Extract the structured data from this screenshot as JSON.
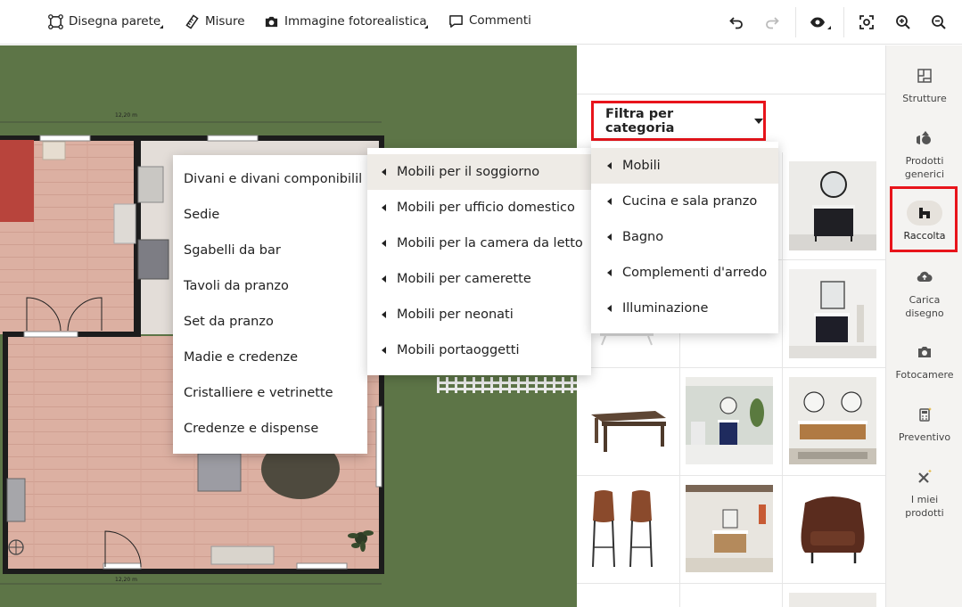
{
  "toolbar": {
    "draw_wall": "Disegna parete",
    "measures": "Misure",
    "photo_image": "Immagine fotorealistica",
    "comments": "Commenti"
  },
  "canvas": {
    "dimension_top": "12,20 m",
    "dimension_bottom": "12,20 m",
    "colors": {
      "grass": "#5d7547",
      "floor": "#dcb0a2",
      "wall": "#1c1c1c"
    }
  },
  "catalog": {
    "filter_label": "Filtra per categoria",
    "categories": [
      {
        "label": "Mobili",
        "active": true
      },
      {
        "label": "Cucina e sala pranzo",
        "active": false
      },
      {
        "label": "Bagno",
        "active": false
      },
      {
        "label": "Complementi d'arredo",
        "active": false
      },
      {
        "label": "Illuminazione",
        "active": false
      }
    ],
    "subcategories": [
      {
        "label": "Mobili per il soggiorno",
        "active": true
      },
      {
        "label": "Mobili per ufficio domestico",
        "active": false
      },
      {
        "label": "Mobili per la camera da letto",
        "active": false
      },
      {
        "label": "Mobili per camerette",
        "active": false
      },
      {
        "label": "Mobili per neonati",
        "active": false
      },
      {
        "label": "Mobili portaoggetti",
        "active": false
      }
    ],
    "items": [
      "Divani e divani componibilil",
      "Sedie",
      "Sgabelli da bar",
      "Tavoli da pranzo",
      "Set da pranzo",
      "Madie e credenze",
      "Cristalliere e vetrinette",
      "Credenze e dispense"
    ],
    "accent_color": "#e8141b"
  },
  "sidebar": {
    "items": [
      {
        "label": "Strutture",
        "icon": "structures-icon"
      },
      {
        "label": "Prodotti generici",
        "icon": "generic-products-icon"
      },
      {
        "label": "Raccolta",
        "icon": "collection-icon",
        "selected": true
      },
      {
        "label": "Carica disegno",
        "icon": "upload-cloud-icon"
      },
      {
        "label": "Fotocamere",
        "icon": "camera-icon"
      },
      {
        "label": "Preventivo",
        "icon": "calculator-icon"
      },
      {
        "label": "I miei prodotti",
        "icon": "my-products-icon"
      }
    ]
  }
}
